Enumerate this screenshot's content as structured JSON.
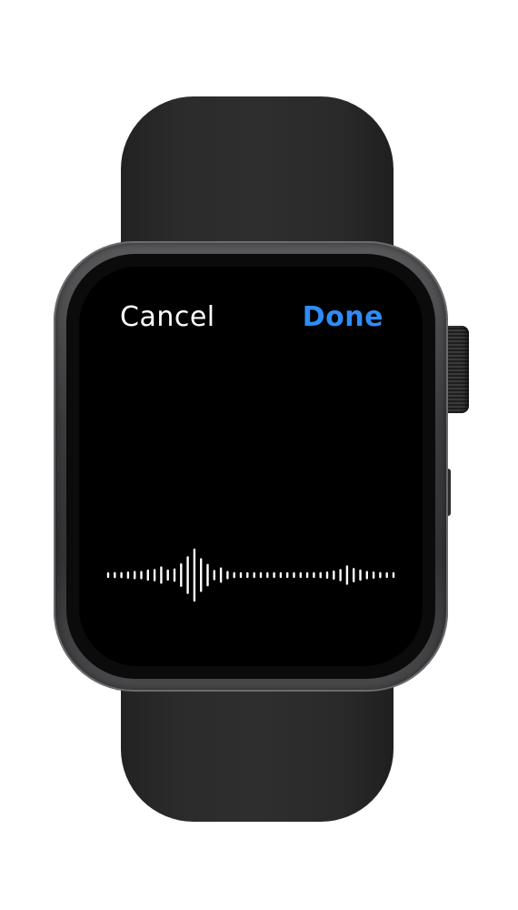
{
  "dictation": {
    "cancel_label": "Cancel",
    "done_label": "Done"
  },
  "colors": {
    "done_accent": "#2f8cf6",
    "screen_background": "#000000",
    "waveform": "#ffffff",
    "band": "#2a2a2a",
    "case": "#3c3c3e"
  },
  "waveform": {
    "levels": [
      0.06,
      0.08,
      0.08,
      0.1,
      0.12,
      0.12,
      0.18,
      0.2,
      0.3,
      0.18,
      0.22,
      0.42,
      0.7,
      1.0,
      0.62,
      0.4,
      0.16,
      0.26,
      0.12,
      0.08,
      0.06,
      0.06,
      0.06,
      0.06,
      0.06,
      0.06,
      0.06,
      0.06,
      0.06,
      0.06,
      0.06,
      0.06,
      0.08,
      0.1,
      0.14,
      0.2,
      0.34,
      0.24,
      0.18,
      0.12,
      0.1,
      0.08,
      0.06,
      0.06
    ]
  }
}
